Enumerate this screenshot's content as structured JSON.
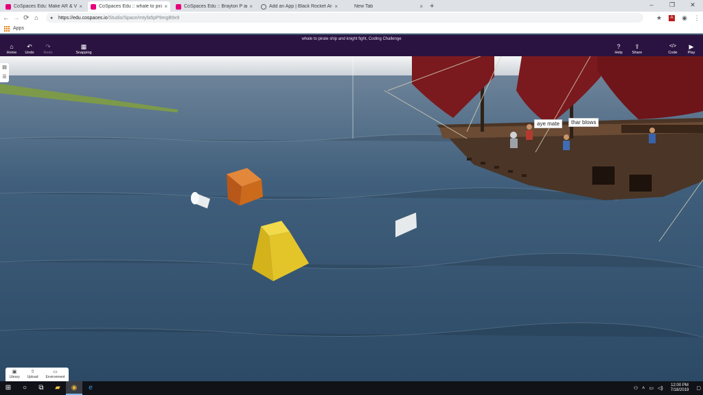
{
  "browser": {
    "tabs": [
      {
        "title": "CoSpaces Edu: Make AR & VR in",
        "favicon": "cospaces-icon",
        "active": false
      },
      {
        "title": "CoSpaces Edu :: whale to pirate",
        "favicon": "cospaces-icon",
        "active": true
      },
      {
        "title": "CoSpaces Edu :: Brayton P and N",
        "favicon": "cospaces-icon",
        "active": false
      },
      {
        "title": "Add an App | Black Rocket Arcad",
        "favicon": "globe-icon",
        "active": false
      },
      {
        "title": "New Tab",
        "favicon": "blank-icon",
        "active": false
      }
    ],
    "new_tab": "+",
    "window_controls": [
      "–",
      "❐",
      "✕"
    ],
    "url_host": "https://edu.cospaces.io",
    "url_path": "/Studio/Space/mtyfa5pP9mgB9x9",
    "bookmarks_label": "Apps"
  },
  "toolbar": {
    "title": "whale to pirate ship and knight fight,     Coding Challenge",
    "left": [
      {
        "label": "Home",
        "icon": "home-icon",
        "glyph": "⌂",
        "enabled": true
      },
      {
        "label": "Undo",
        "icon": "undo-icon",
        "glyph": "↶",
        "enabled": true
      },
      {
        "label": "Redo",
        "icon": "redo-icon",
        "glyph": "↷",
        "enabled": false
      },
      {
        "label": "Snapping",
        "icon": "grid-icon",
        "glyph": "▦",
        "enabled": true
      }
    ],
    "right": [
      {
        "label": "Help",
        "icon": "help-icon",
        "glyph": "?"
      },
      {
        "label": "Share",
        "icon": "share-icon",
        "glyph": "⇪"
      },
      {
        "label": "Code",
        "icon": "code-icon",
        "glyph": "</>"
      },
      {
        "label": "Play",
        "icon": "play-icon",
        "glyph": "▶"
      }
    ]
  },
  "scene": {
    "ship_labels": [
      "aye mate",
      "thar blows"
    ],
    "colors": {
      "sky": "#e9ecef",
      "sea": "#3a5a7a",
      "sail": "#7a1a1e",
      "hull": "#4a3526",
      "cube": "#cc6a1c",
      "pyramid": "#e3c52a"
    }
  },
  "bottom_panel": [
    {
      "label": "Library",
      "icon": "library-icon",
      "glyph": "▣"
    },
    {
      "label": "Upload",
      "icon": "upload-icon",
      "glyph": "⇧"
    },
    {
      "label": "Environment",
      "icon": "environment-icon",
      "glyph": "▭"
    }
  ],
  "taskbar": {
    "time": "12:00 PM",
    "date": "7/18/2019"
  }
}
